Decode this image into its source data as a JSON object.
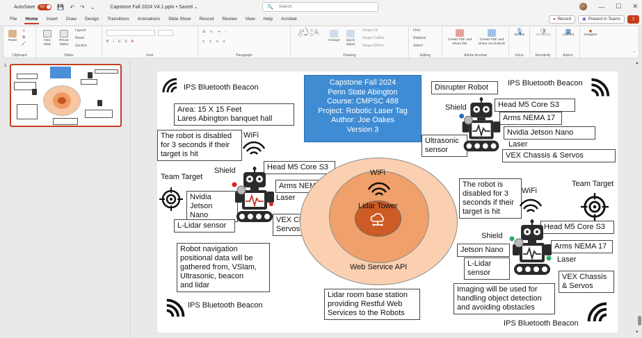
{
  "titlebar": {
    "autosave_label": "AutoSave",
    "autosave_state": "On",
    "filename": "Capstone Fall 2024 V4.1.pptx  •  Saved  ⌄",
    "search_placeholder": "Search",
    "brand_color": "#c43e1c"
  },
  "menu": {
    "tabs": [
      "File",
      "Home",
      "Insert",
      "Draw",
      "Design",
      "Transitions",
      "Animations",
      "Slide Show",
      "Record",
      "Review",
      "View",
      "Help",
      "Acrobat"
    ],
    "active_tab": "Home",
    "record_label": "Record",
    "present_label": "Present in Teams"
  },
  "ribbon": {
    "groups": {
      "clipboard": "Clipboard",
      "slides": "Slides",
      "font": "Font",
      "paragraph": "Paragraph",
      "drawing": "Drawing",
      "editing": "Editing",
      "adobe": "Adobe Acrobat",
      "voice": "Voice",
      "sensitivity": "Sensitivity",
      "addin": "Add-in"
    },
    "buttons": {
      "paste": "Paste",
      "new_slide": "New Slide",
      "reuse_slides": "Reuse Slides",
      "layout": "Layout",
      "reset": "Reset",
      "section": "Section",
      "shapes": "Shapes",
      "arrange": "Arrange",
      "quick_styles": "Quick Styles",
      "shape_fill": "Shape Fill",
      "shape_outline": "Shape Outline",
      "shape_effects": "Shape Effects",
      "find": "Find",
      "replace": "Replace",
      "select": "Select",
      "create_pdf_share": "Create PDF and Share link",
      "create_pdf_outlook": "Create PDF and Share via Outlook",
      "dictate": "Dictate",
      "sensitivity": "Sensitivity",
      "addins": "Add-ins",
      "designer": "Designer"
    }
  },
  "thumbnails": [
    {
      "number": "1"
    }
  ],
  "slide": {
    "title_lines": [
      "Capstone Fall 2024",
      "Penn State Abington",
      "Course: CMPSC 488",
      "Project: Robotic Laser Tag",
      "Author: Joe Oakes",
      "Version 3"
    ],
    "beacon_tl": "IPS Bluetooth Beacon",
    "beacon_tr": "IPS Bluetooth Beacon",
    "beacon_bl": "IPS Bluetooth Beacon",
    "beacon_br": "IPS Bluetooth Beacon",
    "area_text": "Area: 15 X 15 Feet\nLares Abington banquet hall",
    "disabled_left": "The robot is disabled\nfor 3 seconds if their\ntarget is hit",
    "disabled_right": "The robot is\ndisabled for 3\nseconds if their\ntarget is hit",
    "wifi": "WiFi",
    "shield": "Shield",
    "team_target": "Team Target",
    "head": "Head M5 Core S3",
    "arms": "Arms NEMA 17",
    "laser": "Laser",
    "nvidia_left": "Nvidia Jetson\nNano",
    "nvidia_right": "Nvidia Jetson Nano",
    "jetson_right": "Jetson Nano",
    "llidar_left": "L-Lidar sensor",
    "llidar_right": "L-Lidar\nsensor",
    "vex_left": "VEX Chassis &\nServos",
    "vex_top": "VEX Chassis & Servos",
    "vex_right": "VEX Chassis\n& Servos",
    "disrupter": "Disrupter Robot",
    "ultrasonic": "Ultrasonic\nsensor",
    "navigation": "Robot navigation\npositional data will be\ngathered from, VSlam,\nUltrasonic, beacon\nand lidar",
    "lidar_station": "Lidar room base station\nproviding Restful Web\nServices to the Robots",
    "imaging": "Imaging will be used for\nhandling object detection\nand avoiding obstacles",
    "wifi_center": "WiFi",
    "lidar_tower": "Lidar Tower",
    "web_service": "Web Service API",
    "colors": {
      "title_fill": "#3f8cd4",
      "outer_ring": "#fad0b1",
      "middle_ring": "#f0a06a",
      "inner_ring": "#cc5b25"
    }
  }
}
